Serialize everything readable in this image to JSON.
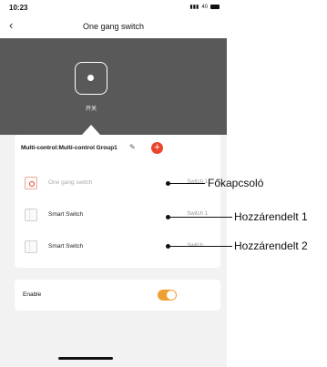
{
  "status_bar": {
    "time": "10:23",
    "signal": "40"
  },
  "nav": {
    "title": "One gang switch",
    "back_icon": "chevron-left-icon"
  },
  "device": {
    "label": "开关"
  },
  "group": {
    "name": "Multi-control:Multi-control Group1",
    "items": [
      {
        "name": "One gang switch",
        "channel": "Switch 1"
      },
      {
        "name": "Smart Switch",
        "channel": "Switch 1"
      },
      {
        "name": "Smart Switch",
        "channel": "Switch..."
      }
    ]
  },
  "enable": {
    "label": "Enable",
    "on": true
  },
  "annotations": [
    "Főkapcsoló",
    "Hozzárendelt 1",
    "Hozzárendelt 2"
  ],
  "colors": {
    "accent": "#e8452c",
    "toggle": "#f0a030",
    "hero_bg": "#595959"
  }
}
